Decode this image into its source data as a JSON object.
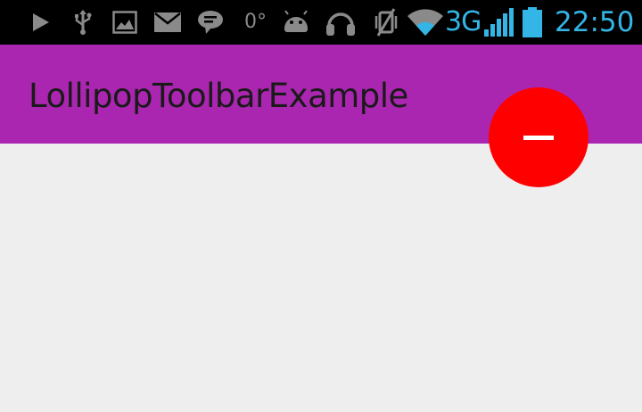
{
  "status_bar": {
    "icons": [
      "play-icon",
      "usb-icon",
      "image-icon",
      "mail-icon",
      "chat-icon",
      "temperature-icon",
      "android-icon",
      "headset-icon",
      "vibrate-off-icon",
      "wifi-icon",
      "signal-icon",
      "battery-icon"
    ],
    "temperature": "0°",
    "network": "3G",
    "time": "22:50"
  },
  "toolbar": {
    "title": "LollipopToolbarExample"
  },
  "fab": {
    "icon": "minus-icon"
  },
  "colors": {
    "status_bar_bg": "#000000",
    "status_accent": "#33b5e5",
    "toolbar_bg": "#aa26b0",
    "content_bg": "#eeeeee",
    "fab_bg": "#ff0000"
  }
}
